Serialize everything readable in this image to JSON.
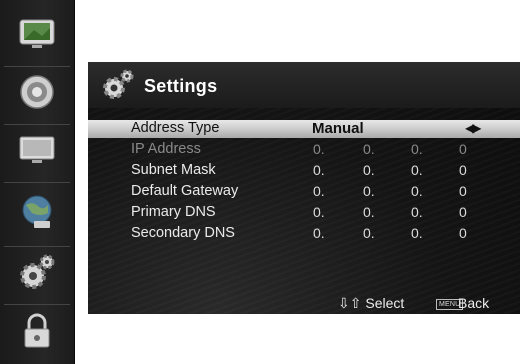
{
  "sidebar": {
    "items": [
      {
        "icon": "tv-picture-icon"
      },
      {
        "icon": "speaker-sound-icon"
      },
      {
        "icon": "screen-display-icon"
      },
      {
        "icon": "network-globe-icon"
      },
      {
        "icon": "settings-gears-icon"
      },
      {
        "icon": "lock-icon"
      }
    ]
  },
  "panel": {
    "title": "Settings",
    "rows": [
      {
        "label": "Address Type",
        "value": "Manual",
        "active": true
      },
      {
        "label": "IP Address",
        "ip": [
          "0.",
          "0.",
          "0.",
          "0"
        ],
        "dim": true
      },
      {
        "label": "Subnet Mask",
        "ip": [
          "0.",
          "0.",
          "0.",
          "0"
        ]
      },
      {
        "label": "Default Gateway",
        "ip": [
          "0.",
          "0.",
          "0.",
          "0"
        ]
      },
      {
        "label": "Primary DNS",
        "ip": [
          "0.",
          "0.",
          "0.",
          "0"
        ]
      },
      {
        "label": "Secondary DNS",
        "ip": [
          "0.",
          "0.",
          "0.",
          "0"
        ]
      }
    ],
    "address_type_arrows": "◀▶",
    "footer": {
      "select_hint": "⇩⇧ Select",
      "menu_key": "MENU",
      "back_hint": "Back"
    }
  },
  "colors": {
    "panel_bg": "#141414",
    "selection_bar": "#cfcfcf",
    "text": "#eaeaea",
    "dim_text": "#8a8a8a"
  }
}
